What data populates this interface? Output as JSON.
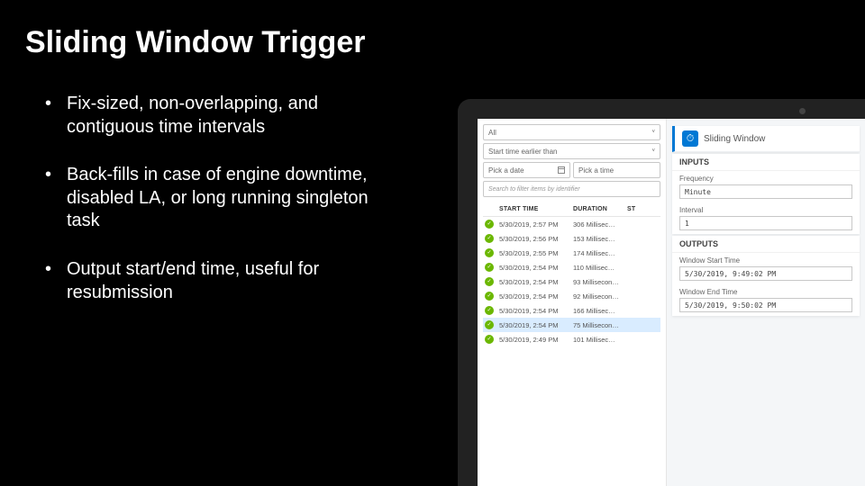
{
  "title": "Sliding Window Trigger",
  "bullets": [
    "Fix-sized, non-overlapping, and contiguous time intervals",
    "Back-fills in case of engine downtime, disabled LA, or long running singleton task",
    "Output start/end time, useful for resubmission"
  ],
  "filters": {
    "status": "All",
    "timeFilter": "Start time earlier than",
    "datePlaceholder": "Pick a date",
    "timePlaceholder": "Pick a time",
    "searchPlaceholder": "Search to filter items by identifier"
  },
  "table": {
    "headers": {
      "start": "START TIME",
      "duration": "DURATION",
      "status": "ST"
    },
    "rows": [
      {
        "start": "5/30/2019, 2:57 PM",
        "duration": "306 Millisec…",
        "selected": false
      },
      {
        "start": "5/30/2019, 2:56 PM",
        "duration": "153 Millisec…",
        "selected": false
      },
      {
        "start": "5/30/2019, 2:55 PM",
        "duration": "174 Millisec…",
        "selected": false
      },
      {
        "start": "5/30/2019, 2:54 PM",
        "duration": "110 Millisec…",
        "selected": false
      },
      {
        "start": "5/30/2019, 2:54 PM",
        "duration": "93 Millisecon…",
        "selected": false
      },
      {
        "start": "5/30/2019, 2:54 PM",
        "duration": "92 Millisecon…",
        "selected": false
      },
      {
        "start": "5/30/2019, 2:54 PM",
        "duration": "166 Millisec…",
        "selected": false
      },
      {
        "start": "5/30/2019, 2:54 PM",
        "duration": "75 Millisecon…",
        "selected": true
      },
      {
        "start": "5/30/2019, 2:49 PM",
        "duration": "101 Millisec…",
        "selected": false
      }
    ]
  },
  "panel": {
    "title": "Sliding Window",
    "sections": {
      "inputs": "INPUTS",
      "outputs": "OUTPUTS"
    },
    "fields": {
      "frequencyLabel": "Frequency",
      "frequencyValue": "Minute",
      "intervalLabel": "Interval",
      "intervalValue": "1",
      "startLabel": "Window Start Time",
      "startValue": "5/30/2019, 9:49:02 PM",
      "endLabel": "Window End Time",
      "endValue": "5/30/2019, 9:50:02 PM"
    }
  }
}
